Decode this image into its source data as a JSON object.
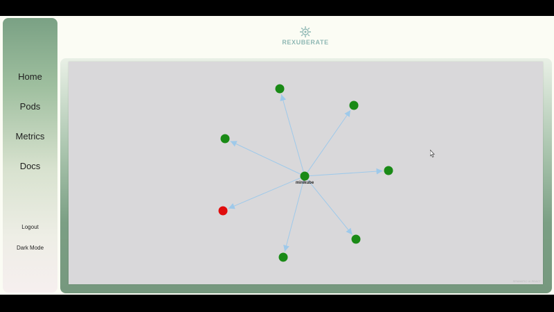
{
  "app": {
    "brand": "REXUBERATE"
  },
  "sidebar": {
    "items": [
      {
        "label": "Home"
      },
      {
        "label": "Pods"
      },
      {
        "label": "Metrics"
      },
      {
        "label": "Docs"
      }
    ],
    "logout": "Logout",
    "dark_mode": "Dark Mode"
  },
  "graph": {
    "center_label": "minikube",
    "edge_color": "#9ec9ea",
    "node_colors": {
      "healthy": "#1a8a16",
      "error": "#e00d0d"
    },
    "nodes": [
      {
        "status": "healthy"
      },
      {
        "status": "healthy"
      },
      {
        "status": "healthy"
      },
      {
        "status": "healthy"
      },
      {
        "status": "error"
      },
      {
        "status": "healthy"
      },
      {
        "status": "healthy"
      }
    ],
    "watermark": "SEMANTIC UI REACT"
  },
  "colors": {
    "background": "#fbfcf4",
    "canvas": "#d9d8da",
    "sidebar_top": "#7aa184",
    "brand_text": "#8fb8b4"
  },
  "icons": {
    "logo": "gear-icon",
    "pointer": "mouse-cursor-icon"
  }
}
